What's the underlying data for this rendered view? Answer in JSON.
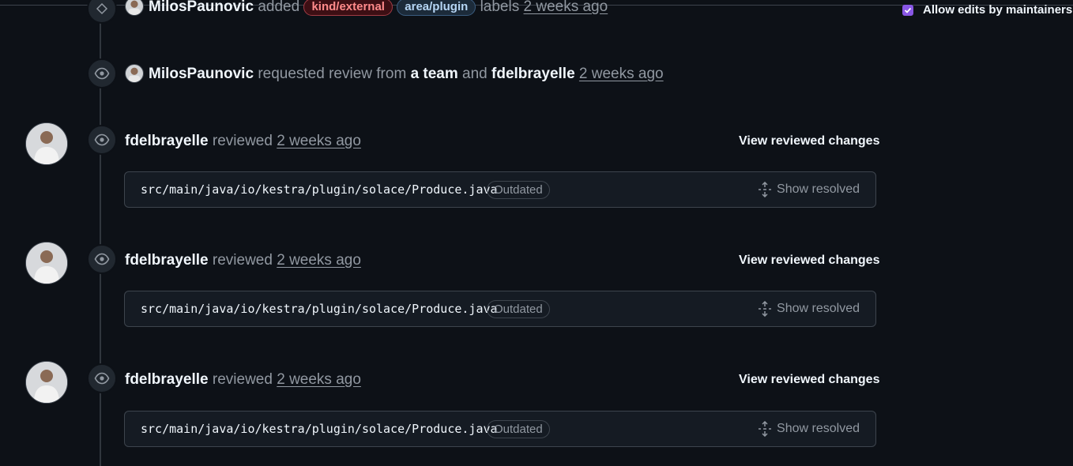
{
  "labels_event": {
    "actor": "MilosPaunovic",
    "verb": "added",
    "labels": [
      {
        "name": "kind/external",
        "color": "#ff8b8b"
      },
      {
        "name": "area/plugin",
        "color": "#b6d6f5"
      }
    ],
    "suffix": "labels",
    "time": "2 weeks ago"
  },
  "review_request_event": {
    "actor": "MilosPaunovic",
    "text1": "requested review from",
    "team": "a team",
    "and": "and",
    "reviewer": "fdelbrayelle",
    "time": "2 weeks ago"
  },
  "sidebar": {
    "allow_edits_label": "Allow edits by maintainers",
    "allow_edits_checked": true
  },
  "reviews": [
    {
      "actor": "fdelbrayelle",
      "verb": "reviewed",
      "time": "2 weeks ago",
      "action": "View reviewed changes",
      "file": "src/main/java/io/kestra/plugin/solace/Produce.java",
      "badge": "Outdated",
      "resolve": "Show resolved"
    },
    {
      "actor": "fdelbrayelle",
      "verb": "reviewed",
      "time": "2 weeks ago",
      "action": "View reviewed changes",
      "file": "src/main/java/io/kestra/plugin/solace/Produce.java",
      "badge": "Outdated",
      "resolve": "Show resolved"
    },
    {
      "actor": "fdelbrayelle",
      "verb": "reviewed",
      "time": "2 weeks ago",
      "action": "View reviewed changes",
      "file": "src/main/java/io/kestra/plugin/solace/Produce.java",
      "badge": "Outdated",
      "resolve": "Show resolved"
    }
  ],
  "colors": {
    "background": "#0d1117",
    "accent_checkbox": "#8957e5",
    "muted_text": "#9198a1"
  },
  "icons": [
    "tag-icon",
    "eye-icon",
    "unfold-icon",
    "check-icon"
  ]
}
